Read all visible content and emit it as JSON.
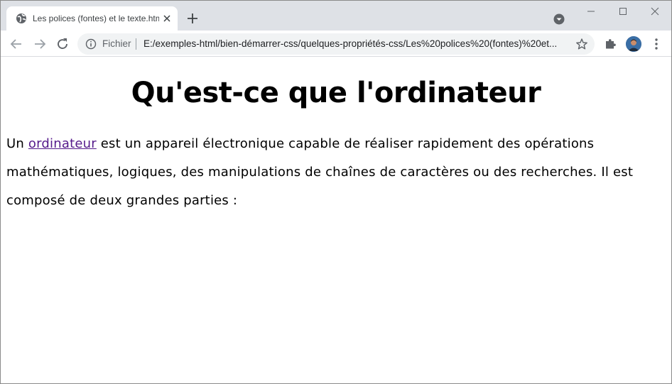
{
  "browser": {
    "tab": {
      "title": "Les polices (fontes) et le texte.htm",
      "favicon": "globe-icon",
      "close_icon": "close-icon"
    },
    "new_tab_icon": "plus-icon",
    "profile_menu_icon": "chevron-down-circle-icon",
    "window_controls": [
      "minimize-icon",
      "maximize-icon",
      "close-icon"
    ],
    "toolbar": {
      "back_icon": "arrow-left-icon",
      "forward_icon": "arrow-right-icon",
      "reload_icon": "reload-icon",
      "scheme_label": "Fichier",
      "url": "E:/exemples-html/bien-démarrer-css/quelques-propriétés-css/Les%20polices%20(fontes)%20et...",
      "bookmark_icon": "star-icon",
      "extensions_icon": "puzzle-icon",
      "menu_icon": "three-dots-vertical-icon"
    }
  },
  "page": {
    "heading": "Qu'est-ce que l'ordinateur",
    "paragraph": {
      "before_link": "Un ",
      "link_text": "ordinateur",
      "after_link": " est un appareil électronique capable de réaliser rapidement des opérations mathématiques, logiques, des manipulations de chaînes de caractères ou des recherches. Il est composé de deux grandes parties :"
    }
  },
  "colors": {
    "tabstrip_bg": "#dee1e6",
    "omnibox_bg": "#f1f3f4",
    "visited_link": "#551a8b"
  }
}
